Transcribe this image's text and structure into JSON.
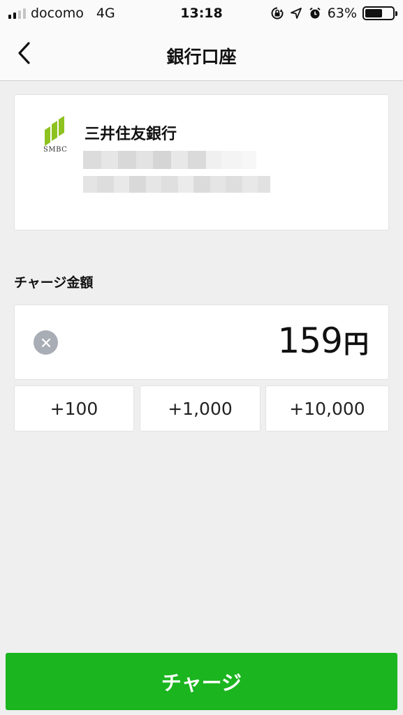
{
  "status_bar": {
    "carrier": "docomo",
    "network": "4G",
    "time": "13:18",
    "battery_percent": "63%",
    "battery_level": 0.63,
    "icons": [
      "rotation-lock-icon",
      "location-arrow-icon",
      "alarm-icon"
    ]
  },
  "nav": {
    "title": "銀行口座",
    "back_icon": "chevron-left-icon"
  },
  "bank": {
    "logo_text": "SMBC",
    "name": "三井住友銀行",
    "logo_color": "#8dc21f"
  },
  "charge": {
    "section_label": "チャージ金額",
    "amount": "159",
    "unit": "円",
    "clear_icon": "close-icon",
    "quick_amounts": [
      "+100",
      "+1,000",
      "+10,000"
    ],
    "button_label": "チャージ",
    "button_color": "#1bb51f"
  }
}
